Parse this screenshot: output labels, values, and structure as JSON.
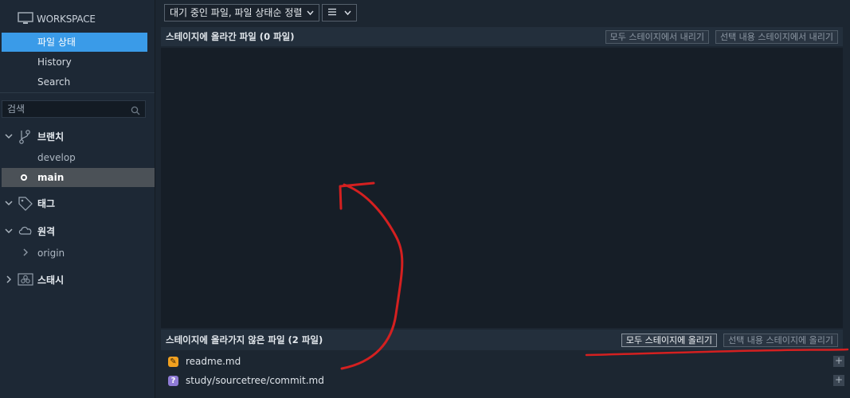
{
  "sidebar": {
    "workspace_label": "WORKSPACE",
    "nav": [
      {
        "label": "파일 상태",
        "active": true
      },
      {
        "label": "History",
        "active": false
      },
      {
        "label": "Search",
        "active": false
      }
    ],
    "search_placeholder": "검색",
    "groups": {
      "branches": {
        "label": "브랜치",
        "items": [
          "develop",
          "main"
        ],
        "current": "main"
      },
      "tags": {
        "label": "태그"
      },
      "remotes": {
        "label": "원격",
        "items": [
          "origin"
        ]
      },
      "stashes": {
        "label": "스태시"
      }
    }
  },
  "toolbar": {
    "sort_dropdown": "대기 중인 파일, 파일 상태순 정렬",
    "view_dropdown_icon": "list-icon"
  },
  "staged": {
    "title": "스테이지에 올라간 파일  (0 파일)",
    "unstage_all": "모두 스테이지에서 내리기",
    "unstage_selected": "선택 내용 스테이지에서 내리기"
  },
  "unstaged": {
    "title": "스테이지에 올라가지 않은 파일  (2 파일)",
    "stage_all": "모두 스테이지에 올리기",
    "stage_selected": "선택 내용 스테이지에 올리기",
    "files": [
      {
        "name": "readme.md",
        "status": "modified",
        "badge": "✎"
      },
      {
        "name": "study/sourcetree/commit.md",
        "status": "untracked",
        "badge": "?"
      }
    ],
    "add_label": "+"
  },
  "colors": {
    "accent": "#3a9be8",
    "annotation": "#d42020",
    "modified": "#f0a020",
    "untracked": "#8f7bd6"
  }
}
